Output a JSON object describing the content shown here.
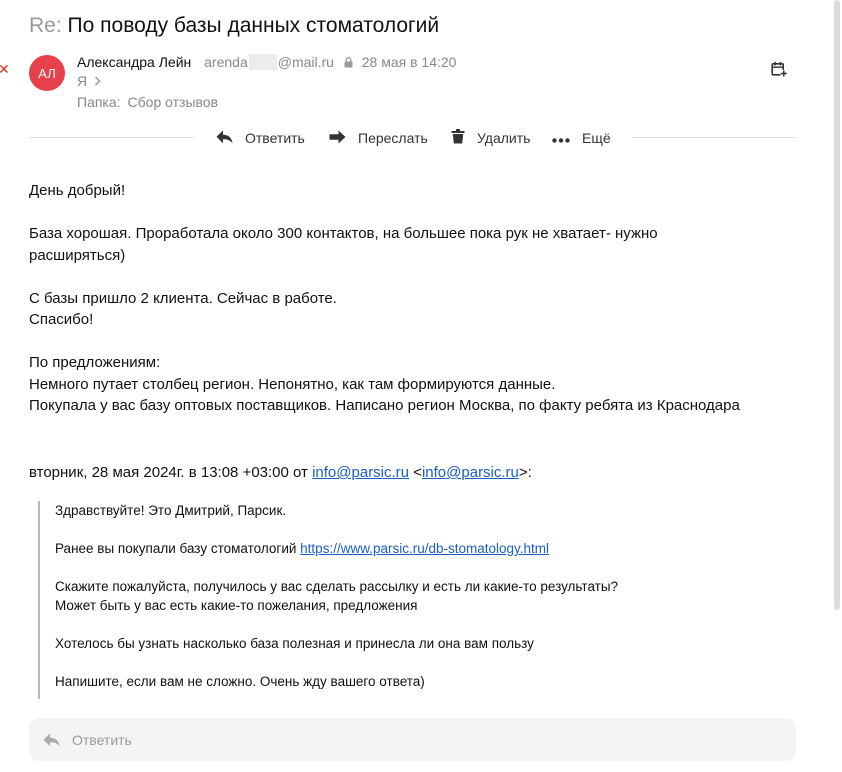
{
  "subject": {
    "prefix": "Re:",
    "text": "По поводу базы данных стоматологий"
  },
  "sender": {
    "initials": "АЛ",
    "avatar_color": "#e8404a",
    "name": "Александра Лейн",
    "email_start": "arenda",
    "email_end": "@mail.ru",
    "date": "28 мая в 14:20"
  },
  "recipient": {
    "label": "Я"
  },
  "folder": {
    "label": "Папка:",
    "value": "Сбор отзывов"
  },
  "toolbar": {
    "reply": "Ответить",
    "forward": "Переслать",
    "delete": "Удалить",
    "more": "Ещё"
  },
  "message": {
    "greeting": "День добрый!",
    "p1_line1": "База хорошая. Проработала около 300 контактов, на большее пока рук не хватает- нужно",
    "p1_line2": "расширяться)",
    "p2_line1": "С базы пришло 2 клиента. Сейчас в работе.",
    "p2_line2": "Спасибо!",
    "p3_line1": "По предложениям:",
    "p3_line2": "Немного путает столбец регион. Непонятно, как там формируются данные.",
    "p3_line3": "Покупала у вас базу оптовых поставщиков. Написано регион Москва, по факту ребята из Краснодара"
  },
  "quote_header": {
    "prefix": "вторник, 28 мая 2024г. в 13:08 +03:00 от ",
    "email": "info@parsic.ru",
    "open": " <",
    "email2": "info@parsic.ru",
    "close": ">:"
  },
  "quote": {
    "line1": "Здравствуйте! Это Дмитрий, Парсик.",
    "line2_text": "Ранее вы покупали базу стоматологий ",
    "line2_link": "https://www.parsic.ru/db-stomatology.html",
    "line3": "Скажите пожалуйста, получилось у вас сделать рассылку и есть ли какие-то результаты?",
    "line4": "Может быть у вас есть какие-то пожелания, предложения",
    "line5": "Хотелось бы узнать насколько база полезная и принесла ли она вам пользу",
    "line6": "Напишите, если вам не сложно. Очень жду вашего ответа)"
  },
  "reply_bar": {
    "placeholder": "Ответить"
  },
  "colors": {
    "link": "#1b5ec7",
    "muted": "#888888",
    "accent_red": "#e0301e"
  }
}
